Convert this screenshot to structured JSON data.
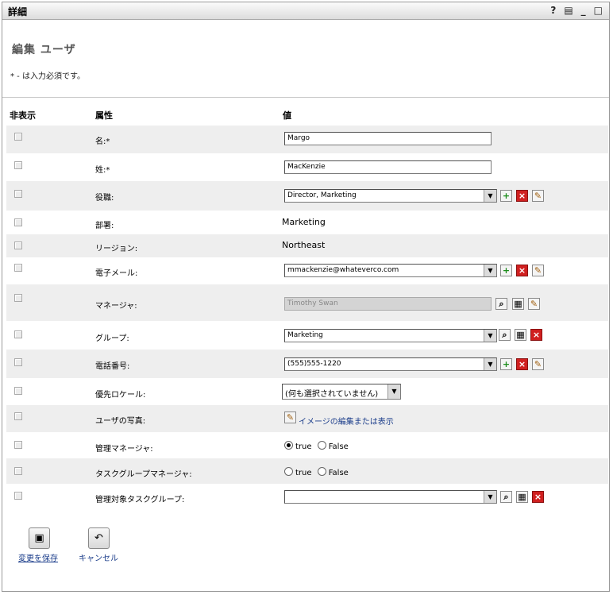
{
  "window": {
    "title": "詳細",
    "icons": [
      "help-icon",
      "print-icon",
      "minimize-icon",
      "maximize-icon"
    ],
    "help_glyph": "?",
    "print_glyph": "▤",
    "min_glyph": "_",
    "max_glyph": "□"
  },
  "page": {
    "title": "編集 ユーザ",
    "required_note": "* - は入力必須です。"
  },
  "columns": {
    "hide": "非表示",
    "attribute": "属性",
    "value": "値"
  },
  "fields": {
    "given_name": {
      "label": "名:*",
      "value": "Margo"
    },
    "surname": {
      "label": "姓:*",
      "value": "MacKenzie"
    },
    "title": {
      "label": "役職:",
      "value": "Director, Marketing"
    },
    "department": {
      "label": "部署:",
      "value": "Marketing"
    },
    "region": {
      "label": "リージョン:",
      "value": "Northeast"
    },
    "email": {
      "label": "電子メール:",
      "value": "mmackenzie@whateverco.com"
    },
    "manager": {
      "label": "マネージャ:",
      "value": "Timothy Swan"
    },
    "group": {
      "label": "グループ:",
      "value": "Marketing"
    },
    "phone": {
      "label": "電話番号:",
      "value": "(555)555-1220"
    },
    "locale": {
      "label": "優先ロケール:",
      "value": "(何も選択されていません)"
    },
    "photo": {
      "label": "ユーザの写真:",
      "link": "イメージの編集または表示"
    },
    "is_manager": {
      "label": "管理マネージャ:",
      "opt_true": "true",
      "opt_false": "False",
      "selected": "true"
    },
    "task_group_manager": {
      "label": "タスクグループマネージャ:",
      "opt_true": "true",
      "opt_false": "False",
      "selected": ""
    },
    "managed_task_groups": {
      "label": "管理対象タスクグループ:",
      "value": ""
    }
  },
  "actions": {
    "save": "変更を保存",
    "cancel": "キャンセル"
  },
  "colors": {
    "row_shade": "#eeeeee",
    "add": "#1a8c1a",
    "delete": "#d02020",
    "link": "#1a3c8a"
  }
}
